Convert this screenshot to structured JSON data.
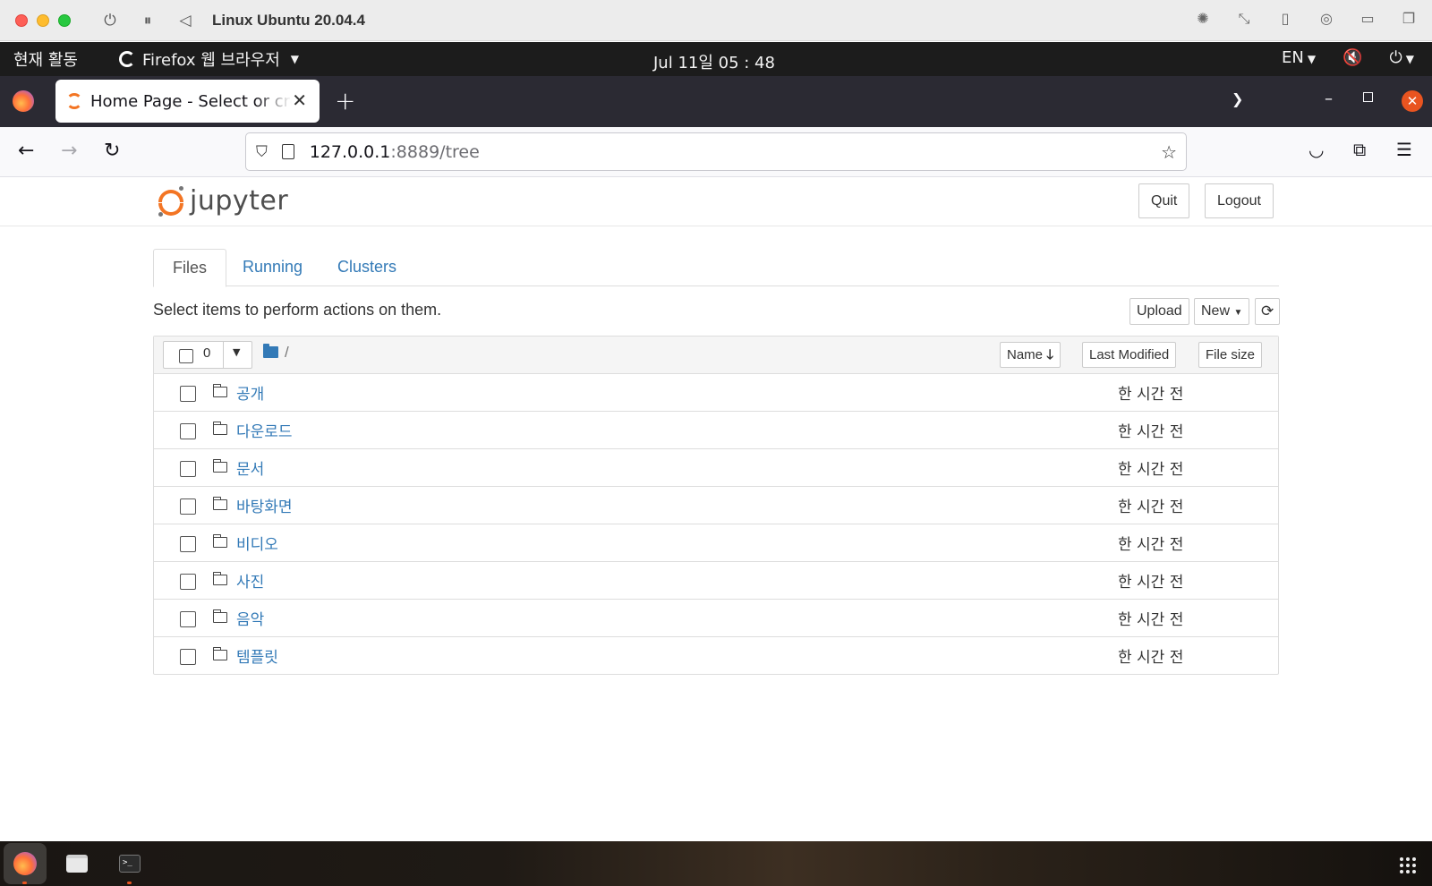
{
  "vm_window": {
    "title": "Linux Ubuntu 20.04.4"
  },
  "ubuntu_topbar": {
    "activities": "현재 활동",
    "app_menu": "Firefox 웹 브라우저",
    "clock": "Jul 11일  05 : 48",
    "language": "EN"
  },
  "browser": {
    "tab_title": "Home Page - Select or create a notebook",
    "url_host": "127.0.0.1",
    "url_rest": ":8889/tree"
  },
  "jupyter": {
    "logo_text": "jupyter",
    "quit_label": "Quit",
    "logout_label": "Logout",
    "tabs": [
      {
        "label": "Files",
        "active": true
      },
      {
        "label": "Running",
        "active": false
      },
      {
        "label": "Clusters",
        "active": false
      }
    ],
    "select_hint": "Select items to perform actions on them.",
    "upload_label": "Upload",
    "new_label": "New",
    "selected_count": "0",
    "breadcrumb": "/",
    "sort_name": "Name",
    "sort_modified": "Last Modified",
    "sort_size": "File size",
    "files": [
      {
        "name": "공개",
        "modified": "한 시간 전"
      },
      {
        "name": "다운로드",
        "modified": "한 시간 전"
      },
      {
        "name": "문서",
        "modified": "한 시간 전"
      },
      {
        "name": "바탕화면",
        "modified": "한 시간 전"
      },
      {
        "name": "비디오",
        "modified": "한 시간 전"
      },
      {
        "name": "사진",
        "modified": "한 시간 전"
      },
      {
        "name": "음악",
        "modified": "한 시간 전"
      },
      {
        "name": "템플릿",
        "modified": "한 시간 전"
      }
    ]
  },
  "colors": {
    "link": "#337ab7",
    "jupyter_orange": "#f37524",
    "ubuntu_orange": "#e95420"
  }
}
